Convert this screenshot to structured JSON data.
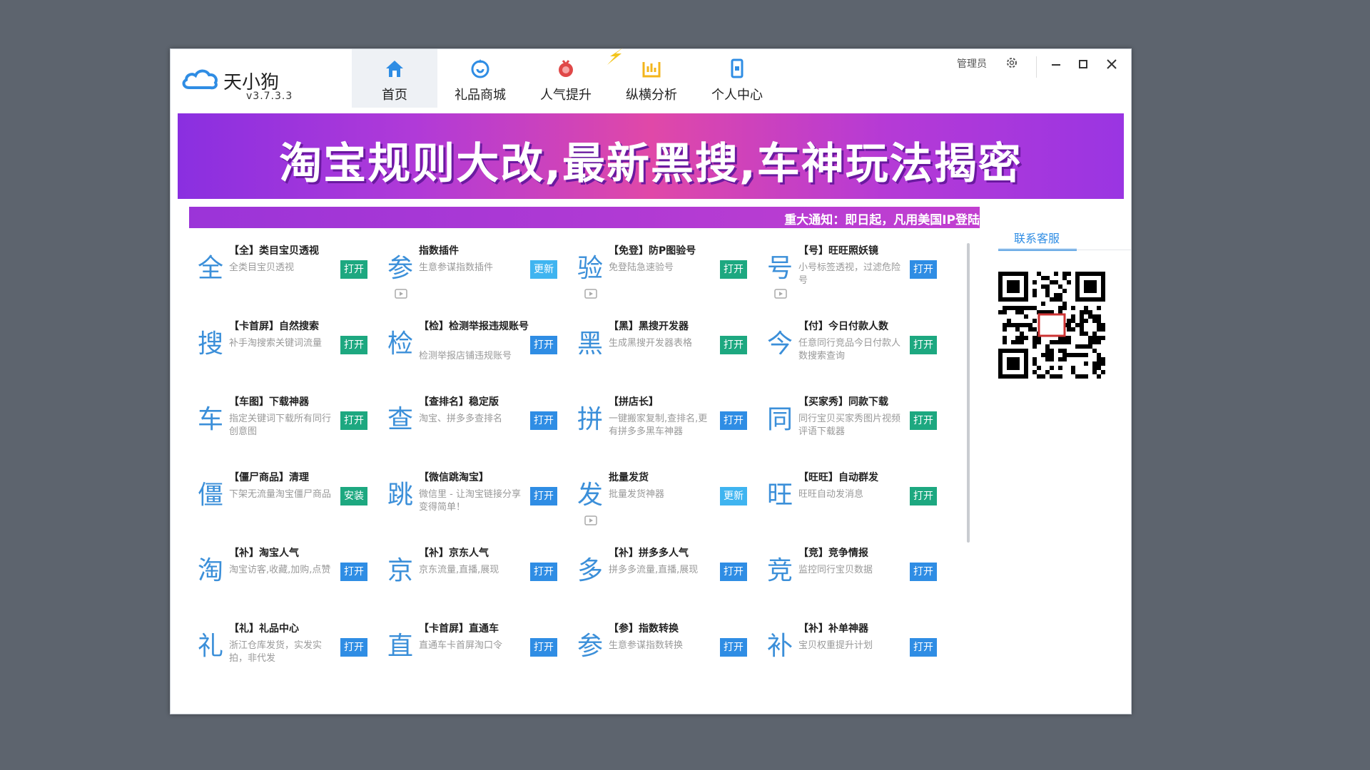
{
  "app": {
    "name": "天小狗",
    "version": "v3.7.3.3"
  },
  "nav": [
    {
      "label": "首页",
      "icon": "home-icon"
    },
    {
      "label": "礼品商城",
      "icon": "gift-mall-icon"
    },
    {
      "label": "人气提升",
      "icon": "popularity-icon"
    },
    {
      "label": "纵横分析",
      "icon": "analysis-icon"
    },
    {
      "label": "个人中心",
      "icon": "phone-icon"
    }
  ],
  "titlebar": {
    "admin": "管理员"
  },
  "banner": {
    "text": "淘宝规则大改,最新黑搜,车神玩法揭密"
  },
  "notice": {
    "text": "重大通知：即日起，凡用美国IP登陆"
  },
  "side": {
    "tab": "联系客服"
  },
  "tools": [
    {
      "char": "全",
      "title": "【全】类目宝贝透视",
      "desc": "全类目宝贝透视",
      "button": "打开",
      "btn_color": "green"
    },
    {
      "char": "参",
      "title": "指数插件",
      "desc": "生意参谋指数插件",
      "button": "更新",
      "btn_color": "lightblue",
      "video": true
    },
    {
      "char": "验",
      "title": "【免登】防P图验号",
      "desc": "免登陆急速验号",
      "button": "打开",
      "btn_color": "green",
      "video": true
    },
    {
      "char": "号",
      "title": "【号】旺旺照妖镜",
      "desc": "小号标签透视，过滤危险号",
      "button": "打开",
      "btn_color": "blue",
      "video": true
    },
    {
      "char": "搜",
      "title": "【卡首屏】自然搜索",
      "desc": "补手淘搜索关键词流量",
      "button": "打开",
      "btn_color": "green"
    },
    {
      "char": "检",
      "title": "【检】检测举报违规账号",
      "desc": "检测举报店铺违规账号",
      "button": "打开",
      "btn_color": "blue",
      "tall": true
    },
    {
      "char": "黑",
      "title": "【黑】黑搜开发器",
      "desc": "生成黑搜开发器表格",
      "button": "打开",
      "btn_color": "green"
    },
    {
      "char": "今",
      "title": "【付】今日付款人数",
      "desc": "任意同行竞品今日付款人数搜索查询",
      "button": "打开",
      "btn_color": "green"
    },
    {
      "char": "车",
      "title": "【车图】下载神器",
      "desc": "指定关键词下载所有同行创意图",
      "button": "打开",
      "btn_color": "green"
    },
    {
      "char": "查",
      "title": "【查排名】稳定版",
      "desc": "淘宝、拼多多查排名",
      "button": "打开",
      "btn_color": "blue"
    },
    {
      "char": "拼",
      "title": "【拼店长】",
      "desc": "一键搬家复制,查排名,更有拼多多黑车神器",
      "button": "打开",
      "btn_color": "blue"
    },
    {
      "char": "同",
      "title": "【买家秀】同款下载",
      "desc": "同行宝贝买家秀图片视频评语下载器",
      "button": "打开",
      "btn_color": "green"
    },
    {
      "char": "僵",
      "title": "【僵尸商品】清理",
      "desc": "下架无流量淘宝僵尸商品",
      "button": "安装",
      "btn_color": "green"
    },
    {
      "char": "跳",
      "title": "【微信跳淘宝】",
      "desc": "微信里 - 让淘宝链接分享变得简单！",
      "button": "打开",
      "btn_color": "blue"
    },
    {
      "char": "发",
      "title": "批量发货",
      "desc": "批量发货神器",
      "button": "更新",
      "btn_color": "lightblue",
      "video": true
    },
    {
      "char": "旺",
      "title": "【旺旺】自动群发",
      "desc": "旺旺自动发消息",
      "button": "打开",
      "btn_color": "green"
    },
    {
      "char": "淘",
      "title": "【补】淘宝人气",
      "desc": "淘宝访客,收藏,加购,点赞",
      "button": "打开",
      "btn_color": "blue"
    },
    {
      "char": "京",
      "title": "【补】京东人气",
      "desc": "京东流量,直播,展现",
      "button": "打开",
      "btn_color": "blue"
    },
    {
      "char": "多",
      "title": "【补】拼多多人气",
      "desc": "拼多多流量,直播,展现",
      "button": "打开",
      "btn_color": "blue"
    },
    {
      "char": "竞",
      "title": "【竞】竞争情报",
      "desc": "监控同行宝贝数据",
      "button": "打开",
      "btn_color": "blue"
    },
    {
      "char": "礼",
      "title": "【礼】礼品中心",
      "desc": "浙江仓库发货，实发实拍，非代发",
      "button": "打开",
      "btn_color": "blue"
    },
    {
      "char": "直",
      "title": "【卡首屏】直通车",
      "desc": "直通车卡首屏淘口令",
      "button": "打开",
      "btn_color": "blue"
    },
    {
      "char": "参",
      "title": "【参】指数转换",
      "desc": "生意参谋指数转换",
      "button": "打开",
      "btn_color": "blue"
    },
    {
      "char": "补",
      "title": "【补】补单神器",
      "desc": "宝贝权重提升计划",
      "button": "打开",
      "btn_color": "blue"
    }
  ]
}
